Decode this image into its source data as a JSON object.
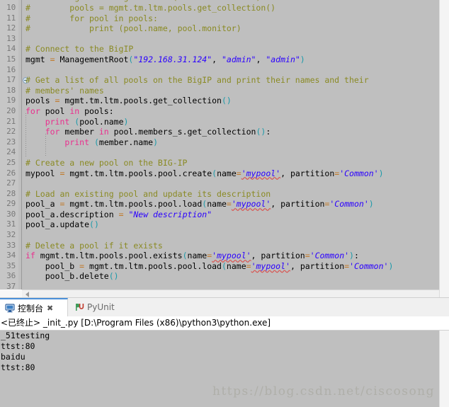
{
  "editor": {
    "first_visible_line": 10,
    "current_line": 37,
    "lines": [
      {
        "no": 10,
        "fold": false,
        "tokens": [
          {
            "t": "#        pools = mgmt.tm.ltm.pools.get_collection()",
            "c": "c-comment"
          }
        ]
      },
      {
        "no": 11,
        "fold": false,
        "tokens": [
          {
            "t": "#        for pool in pools:",
            "c": "c-comment"
          }
        ]
      },
      {
        "no": 12,
        "fold": false,
        "tokens": [
          {
            "t": "#            print (pool.name, pool.monitor)",
            "c": "c-comment"
          }
        ]
      },
      {
        "no": 13,
        "fold": false,
        "tokens": []
      },
      {
        "no": 14,
        "fold": false,
        "tokens": [
          {
            "t": "# Connect to the BigIP",
            "c": "c-comment"
          }
        ]
      },
      {
        "no": 15,
        "fold": false,
        "tokens": [
          {
            "t": "mgmt ",
            "c": "c-plain"
          },
          {
            "t": "=",
            "c": "c-op"
          },
          {
            "t": " ManagementRoot",
            "c": "c-plain"
          },
          {
            "t": "(",
            "c": "c-paren"
          },
          {
            "t": "\"192.168.31.124\"",
            "c": "c-str"
          },
          {
            "t": ", ",
            "c": "c-plain"
          },
          {
            "t": "\"admin\"",
            "c": "c-str"
          },
          {
            "t": ", ",
            "c": "c-plain"
          },
          {
            "t": "\"admin\"",
            "c": "c-str"
          },
          {
            "t": ")",
            "c": "c-paren"
          }
        ]
      },
      {
        "no": 16,
        "fold": false,
        "tokens": []
      },
      {
        "no": 17,
        "fold": true,
        "tokens": [
          {
            "t": "# Get a list of all pools on the BigIP and print their names and their",
            "c": "c-comment"
          }
        ]
      },
      {
        "no": 18,
        "fold": false,
        "tokens": [
          {
            "t": "# members' names",
            "c": "c-comment"
          }
        ]
      },
      {
        "no": 19,
        "fold": false,
        "tokens": [
          {
            "t": "pools ",
            "c": "c-plain"
          },
          {
            "t": "=",
            "c": "c-op"
          },
          {
            "t": " mgmt.tm.ltm.pools.get_collection",
            "c": "c-plain"
          },
          {
            "t": "()",
            "c": "c-paren"
          }
        ]
      },
      {
        "no": 20,
        "fold": false,
        "tokens": [
          {
            "t": "for",
            "c": "c-kw"
          },
          {
            "t": " pool ",
            "c": "c-plain"
          },
          {
            "t": "in",
            "c": "c-kw"
          },
          {
            "t": " pools:",
            "c": "c-plain"
          }
        ]
      },
      {
        "no": 21,
        "fold": false,
        "tokens": [
          {
            "t": "    ",
            "c": "c-plain"
          },
          {
            "t": "print",
            "c": "c-fn"
          },
          {
            "t": " ",
            "c": "c-plain"
          },
          {
            "t": "(",
            "c": "c-paren"
          },
          {
            "t": "pool.name",
            "c": "c-plain"
          },
          {
            "t": ")",
            "c": "c-paren"
          }
        ]
      },
      {
        "no": 22,
        "fold": false,
        "tokens": [
          {
            "t": "    ",
            "c": "c-plain"
          },
          {
            "t": "for",
            "c": "c-kw"
          },
          {
            "t": " member ",
            "c": "c-plain"
          },
          {
            "t": "in",
            "c": "c-kw"
          },
          {
            "t": " pool.members_s.get_collection",
            "c": "c-plain"
          },
          {
            "t": "()",
            "c": "c-paren"
          },
          {
            "t": ":",
            "c": "c-plain"
          }
        ]
      },
      {
        "no": 23,
        "fold": false,
        "tokens": [
          {
            "t": "        ",
            "c": "c-plain"
          },
          {
            "t": "print",
            "c": "c-fn"
          },
          {
            "t": " ",
            "c": "c-plain"
          },
          {
            "t": "(",
            "c": "c-paren"
          },
          {
            "t": "member.name",
            "c": "c-plain"
          },
          {
            "t": ")",
            "c": "c-paren"
          }
        ]
      },
      {
        "no": 24,
        "fold": false,
        "tokens": []
      },
      {
        "no": 25,
        "fold": false,
        "tokens": [
          {
            "t": "# Create a new pool on the BIG-IP",
            "c": "c-comment"
          }
        ]
      },
      {
        "no": 26,
        "fold": false,
        "tokens": [
          {
            "t": "mypool ",
            "c": "c-plain"
          },
          {
            "t": "=",
            "c": "c-op"
          },
          {
            "t": " mgmt.tm.ltm.pools.pool.create",
            "c": "c-plain"
          },
          {
            "t": "(",
            "c": "c-paren"
          },
          {
            "t": "name",
            "c": "c-plain"
          },
          {
            "t": "=",
            "c": "c-op"
          },
          {
            "t": "'mypool'",
            "c": "c-str c-squig"
          },
          {
            "t": ", ",
            "c": "c-plain"
          },
          {
            "t": "partition",
            "c": "c-plain"
          },
          {
            "t": "=",
            "c": "c-op"
          },
          {
            "t": "'Common'",
            "c": "c-str"
          },
          {
            "t": ")",
            "c": "c-paren"
          }
        ]
      },
      {
        "no": 27,
        "fold": false,
        "tokens": []
      },
      {
        "no": 28,
        "fold": false,
        "tokens": [
          {
            "t": "# Load an existing pool and update its description",
            "c": "c-comment"
          }
        ]
      },
      {
        "no": 29,
        "fold": false,
        "tokens": [
          {
            "t": "pool_a ",
            "c": "c-plain"
          },
          {
            "t": "=",
            "c": "c-op"
          },
          {
            "t": " mgmt.tm.ltm.pools.pool.load",
            "c": "c-plain"
          },
          {
            "t": "(",
            "c": "c-paren"
          },
          {
            "t": "name",
            "c": "c-plain"
          },
          {
            "t": "=",
            "c": "c-op"
          },
          {
            "t": "'mypool'",
            "c": "c-str c-squig"
          },
          {
            "t": ", ",
            "c": "c-plain"
          },
          {
            "t": "partition",
            "c": "c-plain"
          },
          {
            "t": "=",
            "c": "c-op"
          },
          {
            "t": "'Common'",
            "c": "c-str"
          },
          {
            "t": ")",
            "c": "c-paren"
          }
        ]
      },
      {
        "no": 30,
        "fold": false,
        "tokens": [
          {
            "t": "pool_a.description ",
            "c": "c-plain"
          },
          {
            "t": "=",
            "c": "c-op"
          },
          {
            "t": " ",
            "c": "c-plain"
          },
          {
            "t": "\"New description\"",
            "c": "c-str"
          }
        ]
      },
      {
        "no": 31,
        "fold": false,
        "tokens": [
          {
            "t": "pool_a.update",
            "c": "c-plain"
          },
          {
            "t": "()",
            "c": "c-paren"
          }
        ]
      },
      {
        "no": 32,
        "fold": false,
        "tokens": []
      },
      {
        "no": 33,
        "fold": false,
        "tokens": [
          {
            "t": "# Delete a pool if it exists",
            "c": "c-comment"
          }
        ]
      },
      {
        "no": 34,
        "fold": false,
        "tokens": [
          {
            "t": "if",
            "c": "c-kw"
          },
          {
            "t": " mgmt.tm.ltm.pools.pool.exists",
            "c": "c-plain"
          },
          {
            "t": "(",
            "c": "c-paren"
          },
          {
            "t": "name",
            "c": "c-plain"
          },
          {
            "t": "=",
            "c": "c-op"
          },
          {
            "t": "'mypool'",
            "c": "c-str c-squig"
          },
          {
            "t": ", ",
            "c": "c-plain"
          },
          {
            "t": "partition",
            "c": "c-plain"
          },
          {
            "t": "=",
            "c": "c-op"
          },
          {
            "t": "'Common'",
            "c": "c-str"
          },
          {
            "t": ")",
            "c": "c-paren"
          },
          {
            "t": ":",
            "c": "c-plain"
          }
        ]
      },
      {
        "no": 35,
        "fold": false,
        "tokens": [
          {
            "t": "    pool_b ",
            "c": "c-plain"
          },
          {
            "t": "=",
            "c": "c-op"
          },
          {
            "t": " mgmt.tm.ltm.pools.pool.load",
            "c": "c-plain"
          },
          {
            "t": "(",
            "c": "c-paren"
          },
          {
            "t": "name",
            "c": "c-plain"
          },
          {
            "t": "=",
            "c": "c-op"
          },
          {
            "t": "'mypool'",
            "c": "c-str c-squig"
          },
          {
            "t": ", ",
            "c": "c-plain"
          },
          {
            "t": "partition",
            "c": "c-plain"
          },
          {
            "t": "=",
            "c": "c-op"
          },
          {
            "t": "'Common'",
            "c": "c-str"
          },
          {
            "t": ")",
            "c": "c-paren"
          }
        ]
      },
      {
        "no": 36,
        "fold": false,
        "tokens": [
          {
            "t": "    pool_b.delete",
            "c": "c-plain"
          },
          {
            "t": "()",
            "c": "c-paren"
          }
        ]
      },
      {
        "no": 37,
        "fold": false,
        "tokens": []
      }
    ]
  },
  "bottom_panel": {
    "tabs": [
      {
        "label": "控制台",
        "icon": "console-monitor-icon",
        "active": true,
        "closable": true
      },
      {
        "label": "PyUnit",
        "icon": "pyunit-icon",
        "active": false,
        "closable": false
      }
    ],
    "console_header": "<已终止> _init_.py [D:\\Program Files (x86)\\python3\\python.exe]",
    "output_lines": [
      "_51testing",
      "ttst:80",
      "baidu",
      "ttst:80"
    ]
  },
  "watermark": "https://blog.csdn.net/ciscosong",
  "colors": {
    "comment": "#8a8a23",
    "keyword": "#ea2f8e",
    "string": "#2a00ff",
    "paren": "#1b9aaa",
    "operator": "#c07828",
    "code_background": "#bfbfbf",
    "gutter_background": "#c6c6c6",
    "current_line": "#e8f1fd",
    "tab_accent": "#4a90d9"
  }
}
